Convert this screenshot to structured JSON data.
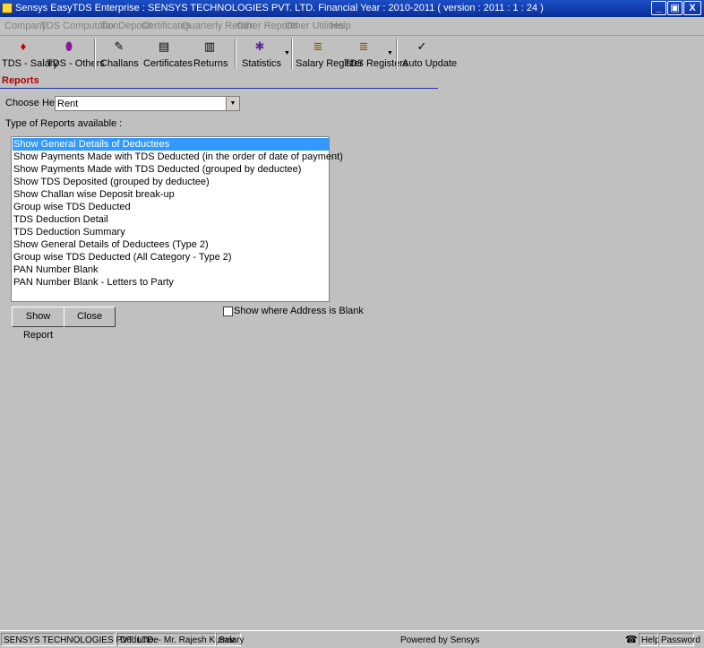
{
  "window": {
    "title": "Sensys EasyTDS Enterprise : SENSYS TECHNOLOGIES PVT. LTD. Financial Year : 2010-2011 ( version : 2011 : 1 : 24 )",
    "controls": {
      "minimize": "_",
      "maximize": "▣",
      "close": "X"
    }
  },
  "menu": [
    "Company",
    "TDS Computation",
    "Tax Deposit",
    "Certificates",
    "Quarterly Return",
    "Other Reports",
    "Other Utilities",
    "Help"
  ],
  "toolbar": {
    "tds_salary": "TDS - Salary",
    "tds_others": "TDS - Others",
    "challans": "Challans",
    "certificates": "Certificates",
    "returns": "Returns",
    "statistics": "Statistics",
    "salary_register": "Salary Register",
    "tds_registers": "TDS Registers",
    "auto_update": "Auto Update"
  },
  "reports": {
    "header": "Reports",
    "choose_head_label": "Choose Head :",
    "choose_head_value": "Rent",
    "types_label": "Type of Reports available :",
    "items": [
      "Show General Details of Deductees",
      "Show Payments Made with TDS Deducted (in the order of date of payment)",
      "Show Payments Made with TDS Deducted (grouped by deductee)",
      "Show TDS Deposited (grouped by deductee)",
      "Show Challan wise Deposit break-up",
      "Group wise TDS Deducted",
      "TDS Deduction Detail",
      "TDS Deduction Summary",
      "Show General Details of Deductees (Type 2)",
      "Group wise TDS Deducted (All Category -  Type 2)",
      "PAN Number Blank",
      "PAN Number Blank - Letters to Party"
    ],
    "selected_index": 0,
    "checkbox_label": "Show where Address is Blank",
    "checkbox_checked": false,
    "show_report_button": "Show Report",
    "close_button": "Close"
  },
  "status": {
    "company": "SENSYS TECHNOLOGIES PVT. LTD.",
    "deductee": "Deductee- Mr. Rajesh  Kumar",
    "head": "Salary",
    "powered": "Powered by Sensys",
    "help": "Help",
    "password": "Password"
  },
  "colors": {
    "title_bar": "#0a2e9a",
    "selection": "#3399ff",
    "reports_header": "#b00000"
  }
}
